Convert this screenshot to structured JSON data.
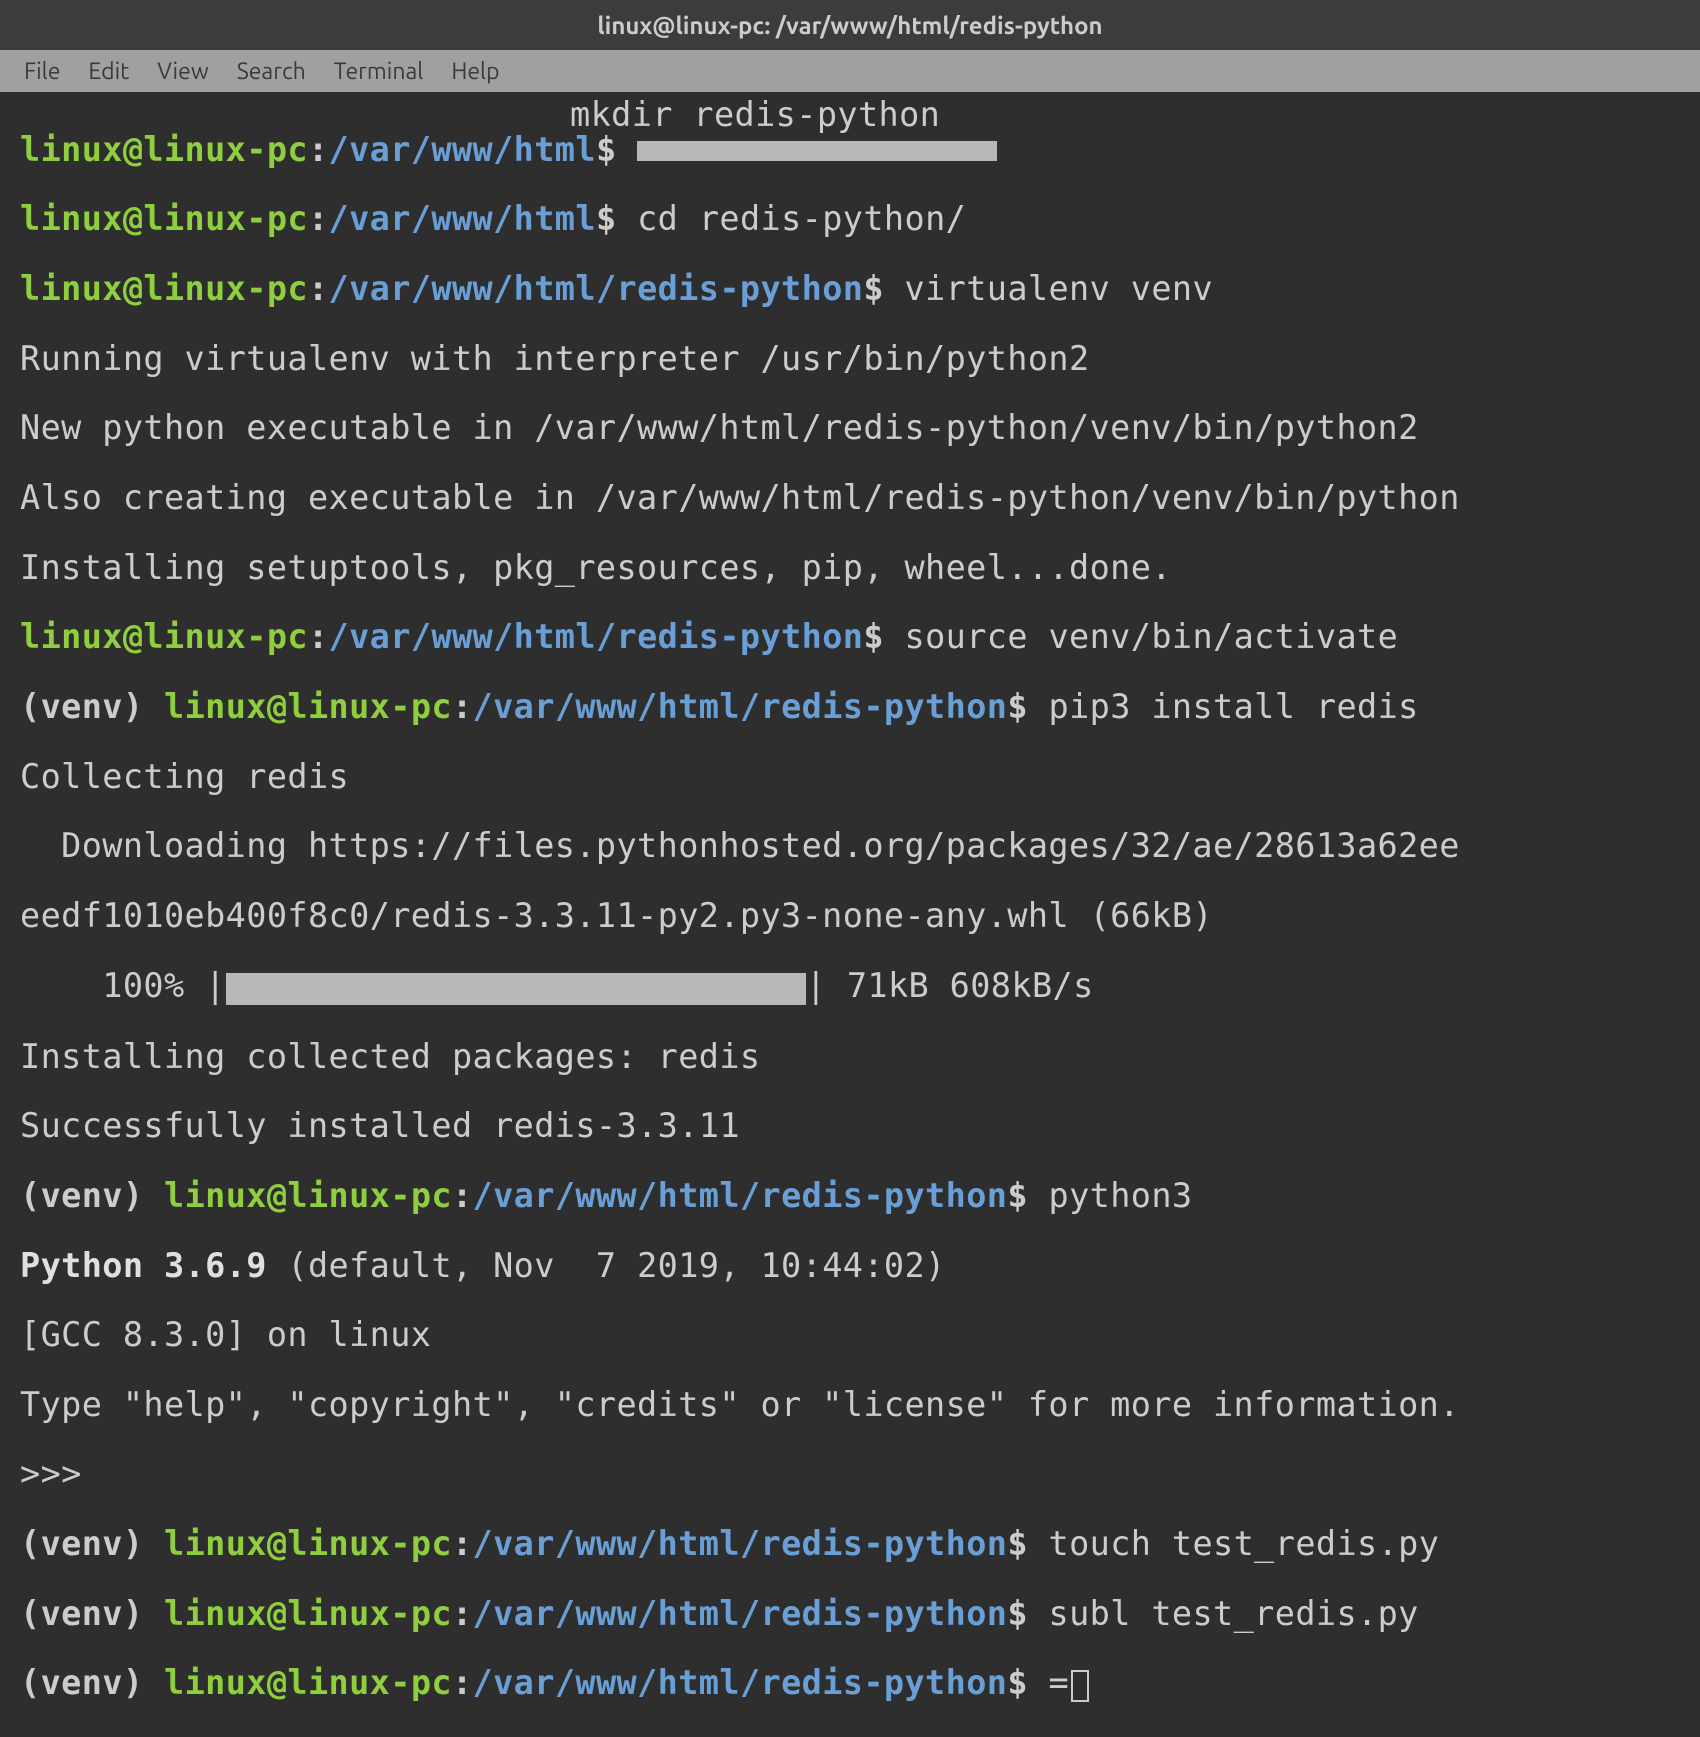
{
  "window": {
    "title": "linux@linux-pc: /var/www/html/redis-python"
  },
  "menu": {
    "file": "File",
    "edit": "Edit",
    "view": "View",
    "search": "Search",
    "terminal": "Terminal",
    "help": "Help"
  },
  "prompt": {
    "user_host": "linux@linux-pc",
    "path_html": "/var/www/html",
    "path_redis": "/var/www/html/redis-python",
    "dollar": "$",
    "colon": ":",
    "venv": "(venv)"
  },
  "commands": {
    "mkdir": "mkdir redis-python",
    "cd": "cd redis-python/",
    "virtualenv": "virtualenv venv",
    "source": "source venv/bin/activate",
    "pip": "pip3 install redis",
    "python3": "python3",
    "touch": "touch test_redis.py",
    "subl": "subl test_redis.py",
    "eq": "="
  },
  "output": {
    "venv1": "Running virtualenv with interpreter /usr/bin/python2",
    "venv2": "New python executable in /var/www/html/redis-python/venv/bin/python2",
    "venv3": "Also creating executable in /var/www/html/redis-python/venv/bin/python",
    "venv4": "Installing setuptools, pkg_resources, pip, wheel...done.",
    "pip1": "Collecting redis",
    "pip2": "  Downloading https://files.pythonhosted.org/packages/32/ae/28613a62ee",
    "pip3": "eedf1010eb400f8c0/redis-3.3.11-py2.py3-none-any.whl (66kB)",
    "pip_prog_pre": "    100% |",
    "pip_prog_post": "| 71kB 608kB/s",
    "pip4": "Installing collected packages: redis",
    "pip5": "Successfully installed redis-3.3.11",
    "py1": "Python 3.6.9 ",
    "py1b": "(default, Nov  7 2019, 10:44:02)",
    "py2": "[GCC 8.3.0] on linux",
    "py3": "Type \"help\", \"copyright\", \"credits\" or \"license\" for more information.",
    "py_prompt": ">>>"
  }
}
